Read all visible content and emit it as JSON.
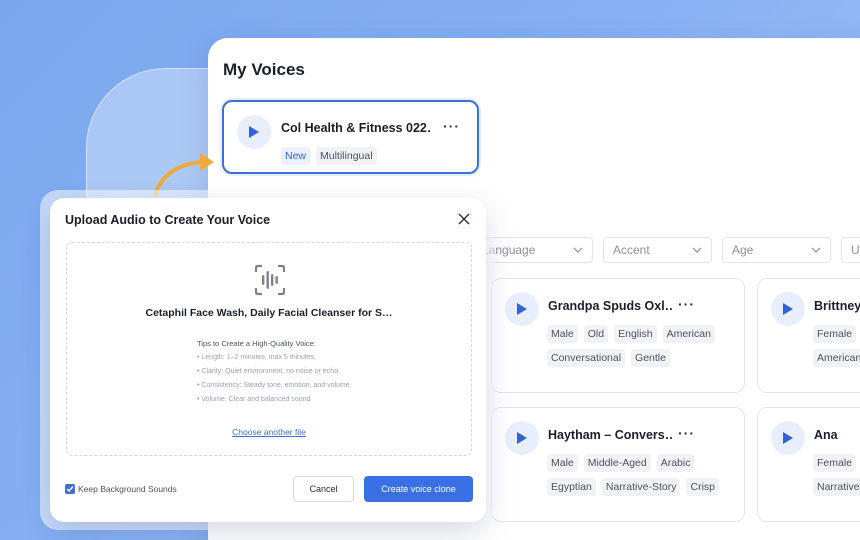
{
  "page": {
    "title": "My Voices"
  },
  "selected_voice": {
    "name": "Col Health & Fitness 022…",
    "tags": [
      "New",
      "Multilingual"
    ],
    "more": "···"
  },
  "filters": [
    {
      "label": "Language"
    },
    {
      "label": "Accent"
    },
    {
      "label": "Age"
    },
    {
      "label": "U"
    }
  ],
  "voices": [
    {
      "name": "Grandpa Spuds Oxl…",
      "tags": [
        "Male",
        "Old",
        "English",
        "American",
        "Conversational",
        "Gentle"
      ],
      "more": "···"
    },
    {
      "name": "Brittney",
      "tags": [
        "Female",
        "American"
      ],
      "more": ""
    },
    {
      "name": "Haytham – Convers…",
      "tags": [
        "Male",
        "Middle-Aged",
        "Arabic",
        "Egyptian",
        "Narrative-Story",
        "Crisp"
      ],
      "more": "···"
    },
    {
      "name": "Ana",
      "tags": [
        "Female",
        "Narrative"
      ],
      "more": ""
    }
  ],
  "dialog": {
    "title": "Upload Audio to Create Your Voice",
    "file_name": "Cetaphil Face Wash, Daily Facial Cleanser for S…",
    "tips_title": "Tips to Create a High-Quality Voice:",
    "tips": [
      "• Length: 1–2 minutes, max 5 minutes.",
      "• Clarity: Quiet environment, no noise or echo.",
      "• Consistency: Steady tone, emotion, and volume.",
      "• Volume: Clear and balanced sound"
    ],
    "choose_link": "Choose another file",
    "keep_label": "Keep Background Sounds",
    "cancel_label": "Cancel",
    "create_label": "Create voice clone"
  },
  "colors": {
    "accent": "#3a6fe5",
    "arrow": "#f2a93b",
    "background": "#7aa7ef"
  },
  "icons": [
    "play-icon",
    "more-icon",
    "chevron-down-icon",
    "close-icon",
    "audio-wave-icon",
    "check-icon",
    "curved-arrow-icon"
  ]
}
